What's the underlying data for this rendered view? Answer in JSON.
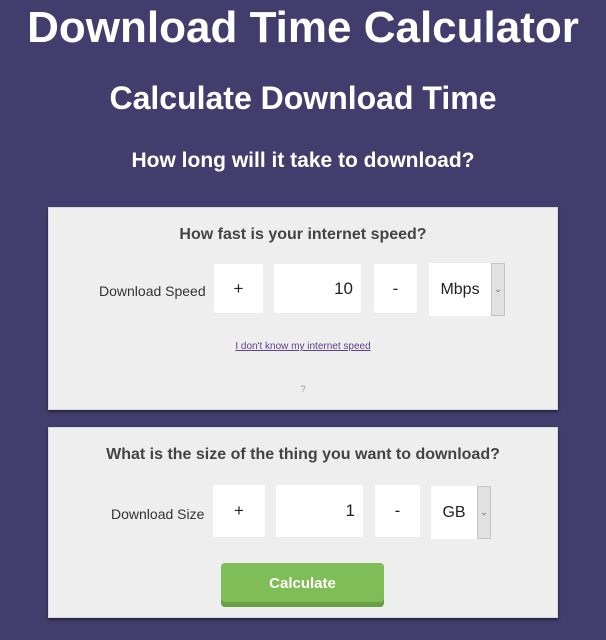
{
  "header": {
    "title": "Download Time Calculator",
    "subtitle": "Calculate Download Time",
    "question": "How long will it take to download?"
  },
  "speed_card": {
    "title": "How fast is your internet speed?",
    "label": "Download Speed",
    "plus": "+",
    "value": "10",
    "minus": "-",
    "unit": "Mbps",
    "link": "I don't know my internet speed",
    "help": "?"
  },
  "size_card": {
    "title": "What is the size of the thing you want to download?",
    "label": "Download Size",
    "plus": "+",
    "value": "1",
    "minus": "-",
    "unit": "GB",
    "calculate": "Calculate"
  },
  "icons": {
    "dropdown": "chevron-down-icon"
  },
  "colors": {
    "background": "#433d6d",
    "card": "#eeeeee",
    "button": "#7fbd56",
    "link": "#5b3f87"
  }
}
